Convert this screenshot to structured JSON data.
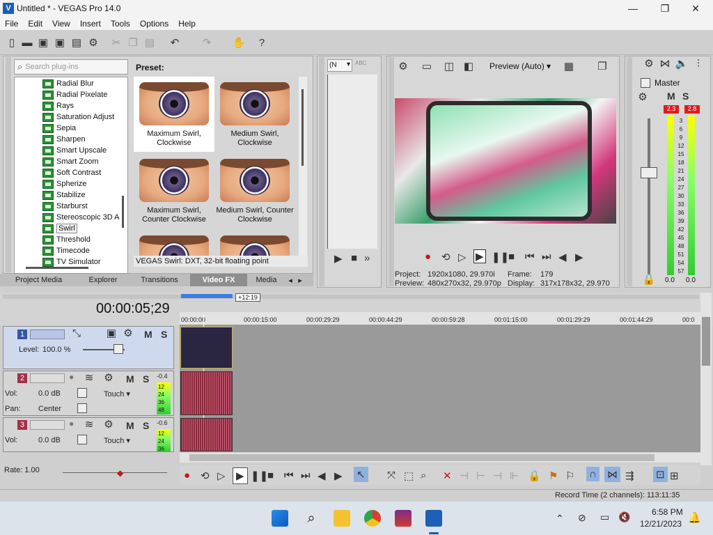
{
  "window": {
    "title": "Untitled * - VEGAS Pro 14.0",
    "minimize": "—",
    "maximize": "❐",
    "close": "✕"
  },
  "menu": [
    "File",
    "Edit",
    "View",
    "Insert",
    "Tools",
    "Options",
    "Help"
  ],
  "plugins": {
    "search_placeholder": "Search plug-ins",
    "items": [
      "Radial Blur",
      "Radial Pixelate",
      "Rays",
      "Saturation Adjust",
      "Sepia",
      "Sharpen",
      "Smart Upscale",
      "Smart Zoom",
      "Soft Contrast",
      "Spherize",
      "Stabilize",
      "Starburst",
      "Stereoscopic 3D A",
      "Swirl",
      "Threshold",
      "Timecode",
      "TV Simulator"
    ],
    "selected": "Swirl"
  },
  "presets": {
    "label": "Preset:",
    "items": [
      "Maximum Swirl, Clockwise",
      "Medium Swirl, Clockwise",
      "Maximum Swirl, Counter Clockwise",
      "Medium Swirl, Counter Clockwise"
    ],
    "status": "VEGAS Swirl: DXT, 32-bit floating point"
  },
  "tabs": [
    "Project Media",
    "Explorer",
    "Transitions",
    "Video FX",
    "Media"
  ],
  "active_tab": "Video FX",
  "trimmer": {
    "select_value": "(N"
  },
  "preview": {
    "mode": "Preview (Auto)",
    "project_label": "Project:",
    "project_value": "1920x1080, 29.970i",
    "preview_label": "Preview:",
    "preview_value": "480x270x32, 29.970p",
    "frame_label": "Frame:",
    "frame_value": "179",
    "display_label": "Display:",
    "display_value": "317x178x32, 29.970"
  },
  "master": {
    "label": "Master",
    "peak_left": "2.3",
    "peak_right": "2.8",
    "scale": [
      "3",
      "6",
      "9",
      "12",
      "15",
      "18",
      "21",
      "24",
      "27",
      "30",
      "33",
      "36",
      "39",
      "42",
      "45",
      "48",
      "51",
      "54",
      "57"
    ],
    "level_left": "0.0",
    "level_right": "0.0"
  },
  "timeline": {
    "timecode": "00:00:05;29",
    "loop_badge": "+12:19",
    "ruler": [
      "00:00:00",
      "00:00:15:00",
      "00:00:29:29",
      "00:00:44:29",
      "00:00:59:28",
      "00:01:15:00",
      "00:01:29:29",
      "00:01:44:29",
      "00:0"
    ]
  },
  "tracks": [
    {
      "num": "1",
      "type": "video",
      "level_label": "Level:",
      "level_value": "100.0 %"
    },
    {
      "num": "2",
      "type": "audio",
      "vol_label": "Vol:",
      "vol_value": "0.0 dB",
      "pan_label": "Pan:",
      "pan_value": "Center",
      "touch": "Touch",
      "meter_top": "-0.4",
      "meter_scale": [
        "12",
        "24",
        "36",
        "48"
      ]
    },
    {
      "num": "3",
      "type": "audio",
      "vol_label": "Vol:",
      "vol_value": "0.0 dB",
      "touch": "Touch",
      "meter_top": "-0.6",
      "meter_scale": [
        "12",
        "24",
        "36"
      ]
    }
  ],
  "rate": "Rate: 1.00",
  "status": {
    "record_time": "Record Time (2 channels): 113:11:35"
  },
  "taskbar": {
    "time": "6:58 PM",
    "date": "12/21/2023"
  }
}
